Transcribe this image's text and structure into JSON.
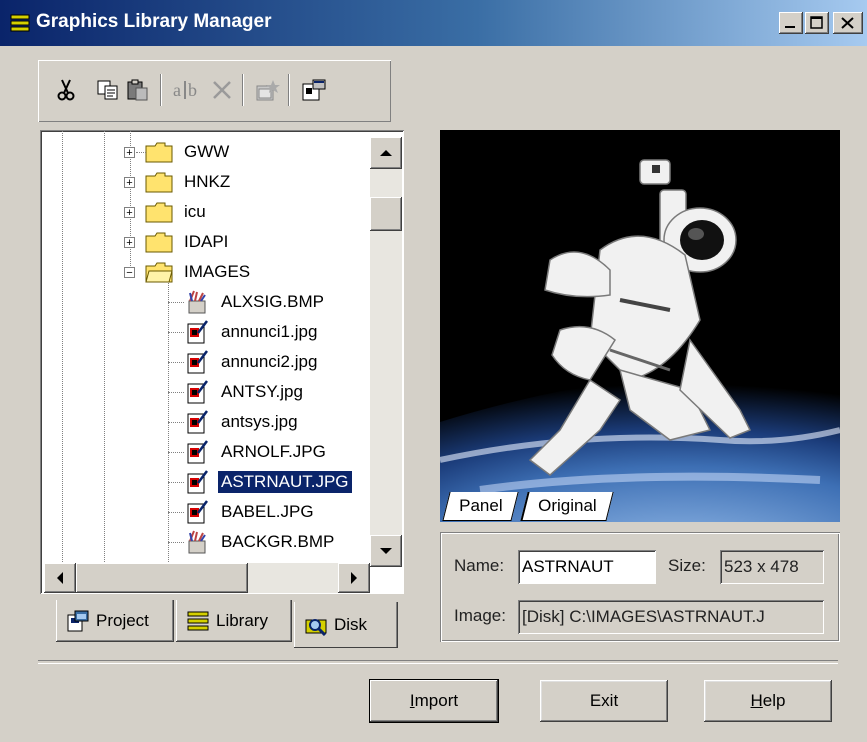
{
  "window": {
    "title": "Graphics Library Manager"
  },
  "toolbar": {
    "items": [
      "cut-icon",
      "copy-icon",
      "paste-icon",
      "rename-icon",
      "delete-icon",
      "properties-icon",
      "settings-icon"
    ]
  },
  "tree": {
    "folders": [
      "GWW",
      "HNKZ",
      "icu",
      "IDAPI",
      "IMAGES"
    ],
    "files": [
      "ALXSIG.BMP",
      "annunci1.jpg",
      "annunci2.jpg",
      "ANTSY.jpg",
      "antsys.jpg",
      "ARNOLF.JPG",
      "ASTRNAUT.JPG",
      "BABEL.JPG",
      "BACKGR.BMP"
    ],
    "selected": "ASTRNAUT.JPG"
  },
  "left_tabs": {
    "project": "Project",
    "library": "Library",
    "disk": "Disk"
  },
  "preview_tabs": {
    "panel": "Panel",
    "original": "Original"
  },
  "info": {
    "name_label": "Name:",
    "name_value": "ASTRNAUT",
    "size_label": "Size:",
    "size_value": "523 x 478",
    "image_label": "Image:",
    "image_value": "[Disk] C:\\IMAGES\\ASTRNAUT.J"
  },
  "buttons": {
    "import": {
      "underline": "I",
      "rest": "mport"
    },
    "exit": "Exit",
    "help": {
      "underline": "H",
      "rest": "elp"
    }
  },
  "colors": {
    "selection": "#0a246a",
    "titlebar": "#0a246a",
    "face": "#d4d0c8"
  }
}
